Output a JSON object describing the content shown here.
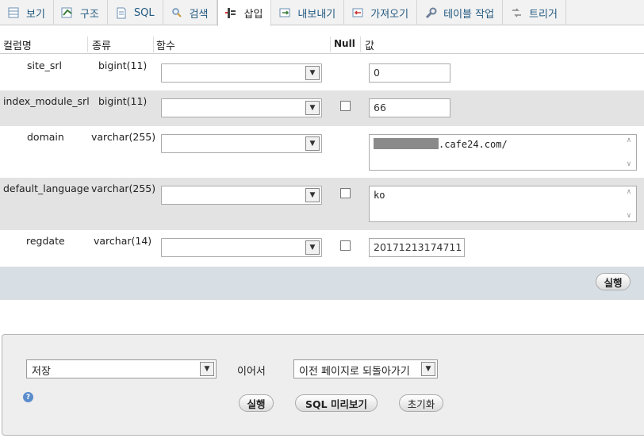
{
  "tabs": [
    {
      "label": "보기",
      "icon": "table-browse-icon",
      "active": false
    },
    {
      "label": "구조",
      "icon": "structure-icon",
      "active": false
    },
    {
      "label": "SQL",
      "icon": "sql-icon",
      "active": false
    },
    {
      "label": "검색",
      "icon": "search-icon",
      "active": false
    },
    {
      "label": "삽입",
      "icon": "insert-icon",
      "active": true
    },
    {
      "label": "내보내기",
      "icon": "export-icon",
      "active": false
    },
    {
      "label": "가져오기",
      "icon": "import-icon",
      "active": false
    },
    {
      "label": "테이블 작업",
      "icon": "wrench-icon",
      "active": false
    },
    {
      "label": "트리거",
      "icon": "trigger-icon",
      "active": false
    }
  ],
  "columns_header": {
    "name": "컬럼명",
    "type": "종류",
    "function": "함수",
    "null": "Null",
    "value": "값"
  },
  "fields": [
    {
      "name": "site_srl",
      "type": "bigint(11)",
      "function": "",
      "has_null": false,
      "value": "0"
    },
    {
      "name": "index_module_srl",
      "type": "bigint(11)",
      "function": "",
      "has_null": true,
      "value": "66"
    },
    {
      "name": "domain",
      "type": "varchar(255)",
      "function": "",
      "has_null": false,
      "value": ".cafe24.com/"
    },
    {
      "name": "default_language",
      "type": "varchar(255)",
      "function": "",
      "has_null": true,
      "value": "ko"
    },
    {
      "name": "regdate",
      "type": "varchar(14)",
      "function": "",
      "has_null": true,
      "value": "20171213174711"
    }
  ],
  "action_bar": {
    "execute_label": "실행"
  },
  "bottom_form": {
    "action_select": "저장",
    "then_label": "이어서",
    "after_select": "이전 페이지로 되돌아가기",
    "execute_label": "실행",
    "preview_label": "SQL 미리보기",
    "reset_label": "초기화"
  }
}
